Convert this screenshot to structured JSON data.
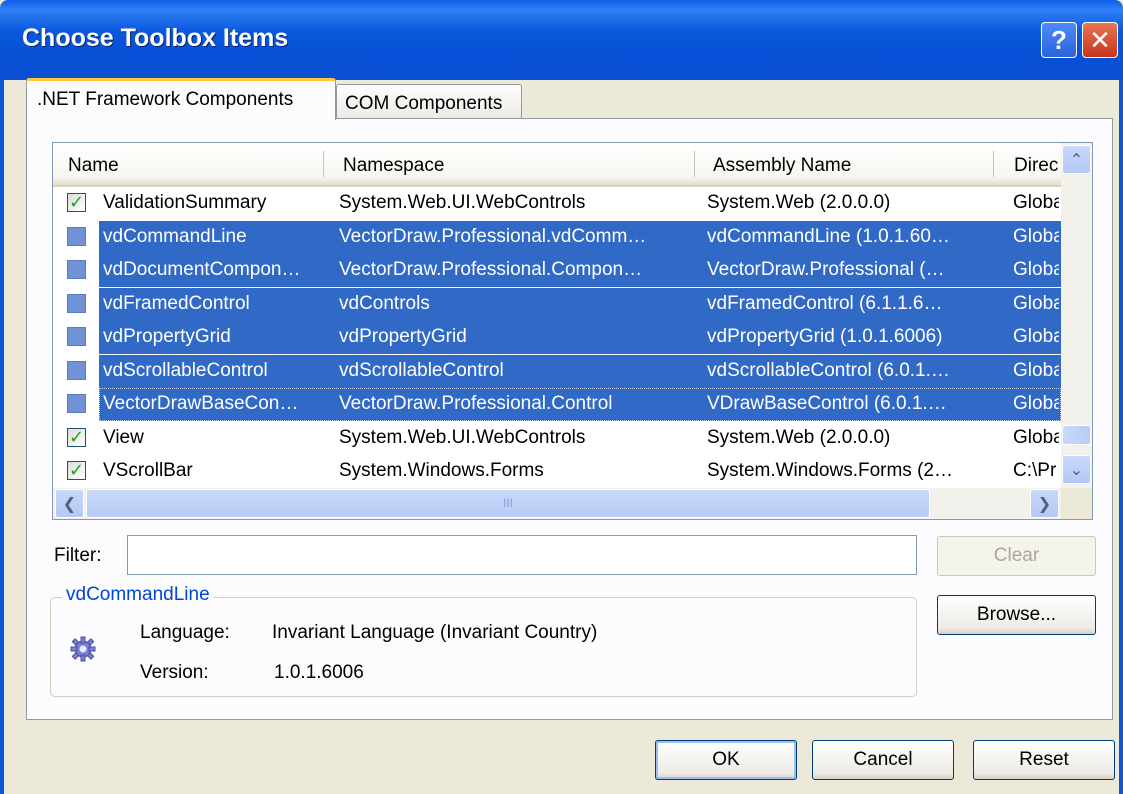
{
  "window": {
    "title": "Choose Toolbox Items",
    "help_glyph": "?",
    "close_glyph": "✕"
  },
  "tabs": [
    {
      "label": ".NET Framework Components",
      "active": true
    },
    {
      "label": "COM Components",
      "active": false
    }
  ],
  "list": {
    "columns": [
      "Name",
      "Namespace",
      "Assembly Name",
      "Direc"
    ],
    "rows": [
      {
        "checked": true,
        "selected": false,
        "name": "ValidationSummary",
        "namespace": "System.Web.UI.WebControls",
        "assembly": "System.Web (2.0.0.0)",
        "directory": "Globa"
      },
      {
        "checked": false,
        "selected": true,
        "name": "vdCommandLine",
        "namespace": "VectorDraw.Professional.vdComm…",
        "assembly": "vdCommandLine (1.0.1.60…",
        "directory": "Globa"
      },
      {
        "checked": false,
        "selected": true,
        "name": "vdDocumentCompon…",
        "namespace": "VectorDraw.Professional.Compon…",
        "assembly": "VectorDraw.Professional (…",
        "directory": "Globa"
      },
      {
        "checked": false,
        "selected": true,
        "name": "vdFramedControl",
        "namespace": "vdControls",
        "assembly": "vdFramedControl (6.1.1.6…",
        "directory": "Globa"
      },
      {
        "checked": false,
        "selected": true,
        "name": "vdPropertyGrid",
        "namespace": "vdPropertyGrid",
        "assembly": "vdPropertyGrid (1.0.1.6006)",
        "directory": "Globa"
      },
      {
        "checked": false,
        "selected": true,
        "name": "vdScrollableControl",
        "namespace": "vdScrollableControl",
        "assembly": "vdScrollableControl (6.0.1.…",
        "directory": "Globa"
      },
      {
        "checked": false,
        "selected": true,
        "name": "VectorDrawBaseCon…",
        "namespace": "VectorDraw.Professional.Control",
        "assembly": "VDrawBaseControl (6.0.1.…",
        "directory": "Globa"
      },
      {
        "checked": true,
        "selected": false,
        "name": "View",
        "namespace": "System.Web.UI.WebControls",
        "assembly": "System.Web (2.0.0.0)",
        "directory": "Globa"
      },
      {
        "checked": true,
        "selected": false,
        "name": "VScrollBar",
        "namespace": "System.Windows.Forms",
        "assembly": "System.Windows.Forms (2…",
        "directory": "C:\\Pr"
      }
    ],
    "check_glyph": "✓",
    "scroll_up_glyph": "⌃",
    "scroll_down_glyph": "⌄",
    "scroll_left_glyph": "❮",
    "scroll_right_glyph": "❯",
    "hthumb_grip": "III"
  },
  "filter": {
    "label": "Filter:",
    "value": "",
    "clear_label": "Clear"
  },
  "details": {
    "title": "vdCommandLine",
    "language_label": "Language:",
    "language_value": "Invariant Language (Invariant Country)",
    "version_label": "Version:",
    "version_value": "1.0.1.6006"
  },
  "buttons": {
    "browse": "Browse...",
    "ok": "OK",
    "cancel": "Cancel",
    "reset": "Reset"
  },
  "colors": {
    "titlebar": "#0a58dc",
    "selection": "#3169c6",
    "check": "#21a121",
    "group_title": "#0046d5"
  }
}
